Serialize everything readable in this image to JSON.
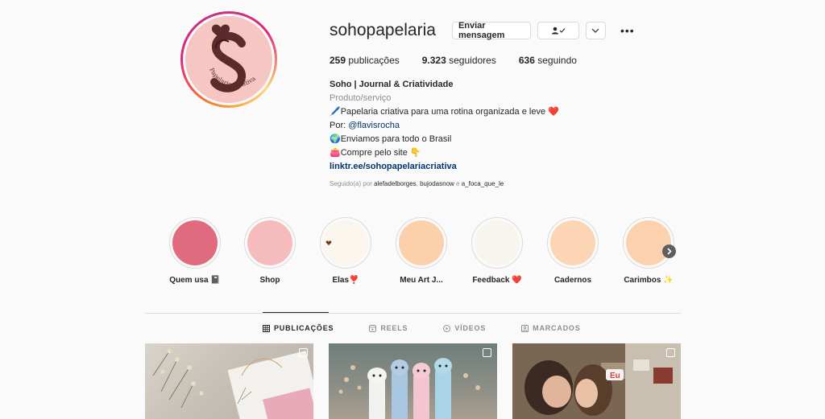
{
  "profile": {
    "username": "sohopapelaria",
    "message_button": "Enviar mensagem",
    "following_icon": "person-check-icon",
    "more": "•••",
    "avatar_text": "Papelaria Criativa"
  },
  "stats": {
    "posts_count": "259",
    "posts_label": "publicações",
    "followers_count": "9.323",
    "followers_label": "seguidores",
    "following_count": "636",
    "following_label": "seguindo"
  },
  "bio": {
    "name": "Soho | Journal & Criatividade",
    "category": "Produto/serviço",
    "line1": "🖊️Papelaria criativa para uma rotina organizada e leve ❤️",
    "line2_prefix": "Por: ",
    "line2_mention": "@flavisrocha",
    "line3": "🌍Enviamos para todo o Brasil",
    "line4": "👛Compre pelo site 👇",
    "link": "linktr.ee/sohopapelariacriativa"
  },
  "followed_by": {
    "prefix": "Seguido(a) por ",
    "user1": "alefadelborges",
    "sep1": ", ",
    "user2": "bujodasnow",
    "sep2": " e ",
    "user3": "a_foca_que_le"
  },
  "highlights": [
    {
      "label": "Quem usa 📓",
      "color": "#e06b7f"
    },
    {
      "label": "Shop",
      "color": "#f6bcbd"
    },
    {
      "label": "Elas❣️",
      "color": "#faf6ee"
    },
    {
      "label": "Meu Art J...",
      "color": "#fbd0aa"
    },
    {
      "label": "Feedback ❤️",
      "color": "#f8f5ef"
    },
    {
      "label": "Cadernos",
      "color": "#fbd5b4"
    },
    {
      "label": "Carimbos ✨",
      "color": "#fbd2ad"
    }
  ],
  "tabs": [
    {
      "label": "PUBLICAÇÕES",
      "icon": "grid-icon",
      "active": true
    },
    {
      "label": "REELS",
      "icon": "reels-icon",
      "active": false
    },
    {
      "label": "VÍDEOS",
      "icon": "play-icon",
      "active": false
    },
    {
      "label": "MARCADOS",
      "icon": "tag-icon",
      "active": false
    }
  ],
  "posts_overlay": {
    "badge": "Eu"
  }
}
